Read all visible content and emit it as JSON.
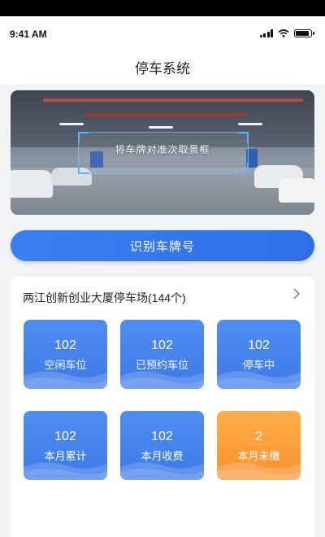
{
  "status_bar": {
    "time": "9:41 AM"
  },
  "header": {
    "title": "停车系统"
  },
  "camera": {
    "hint": "将车牌对准次取景框"
  },
  "actions": {
    "recognize_label": "识别车牌号"
  },
  "lot": {
    "name": "两江创新创业大厦停车场(144个)",
    "stats": [
      {
        "value": "102",
        "label": "空闲车位",
        "color": "blue"
      },
      {
        "value": "102",
        "label": "已预约车位",
        "color": "blue"
      },
      {
        "value": "102",
        "label": "停车中",
        "color": "blue"
      },
      {
        "value": "102",
        "label": "本月累计",
        "color": "blue"
      },
      {
        "value": "102",
        "label": "本月收费",
        "color": "blue"
      },
      {
        "value": "2",
        "label": "本月未缴",
        "color": "orange"
      }
    ]
  },
  "colors": {
    "primary": "#2f6ee8",
    "warning": "#f7902a",
    "background": "#f2f3f5"
  },
  "icons": {
    "signal": "signal-icon",
    "wifi": "wifi-icon",
    "battery": "battery-icon",
    "chevron": "chevron-right-icon"
  }
}
